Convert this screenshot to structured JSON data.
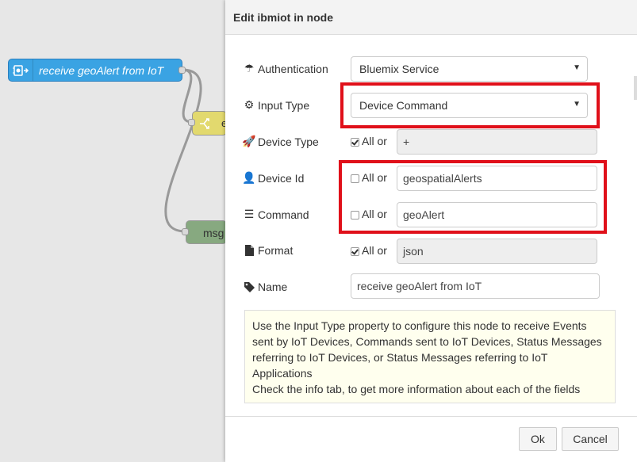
{
  "canvas": {
    "main_node_label": "receive geoAlert from IoT",
    "switch_node_label": "e",
    "msg_node_label": "msg"
  },
  "dialog": {
    "title": "Edit ibmiot in node",
    "fields": {
      "authentication": {
        "label": "Authentication",
        "icon": "umbrella-icon",
        "value": "Bluemix Service"
      },
      "input_type": {
        "label": "Input Type",
        "icon": "cogs-icon",
        "value": "Device Command"
      },
      "device_type": {
        "label": "Device Type",
        "icon": "rocket-icon",
        "all_label": "All or",
        "all_checked": true,
        "value": "+"
      },
      "device_id": {
        "label": "Device Id",
        "icon": "user-icon",
        "all_label": "All or",
        "all_checked": false,
        "value": "geospatialAlerts"
      },
      "command": {
        "label": "Command",
        "icon": "list-icon",
        "all_label": "All or",
        "all_checked": false,
        "value": "geoAlert"
      },
      "format": {
        "label": "Format",
        "icon": "file-icon",
        "all_label": "All or",
        "all_checked": true,
        "value": "json"
      },
      "name": {
        "label": "Name",
        "icon": "tag-icon",
        "value": "receive geoAlert from IoT"
      }
    },
    "tip": {
      "line1": "Use the Input Type property to configure this node to receive Events sent by IoT Devices, Commands sent to IoT Devices, Status Messages referring to IoT Devices, or Status Messages referring to IoT Applications",
      "line2": "Check the info tab, to get more information about each of the fields"
    },
    "buttons": {
      "ok": "Ok",
      "cancel": "Cancel"
    }
  },
  "colors": {
    "highlight": "#e0101a",
    "main_node": "#3aa3e3",
    "switch_node": "#e2d96e",
    "msg_node": "#87a980",
    "tip_bg": "#ffffee"
  }
}
